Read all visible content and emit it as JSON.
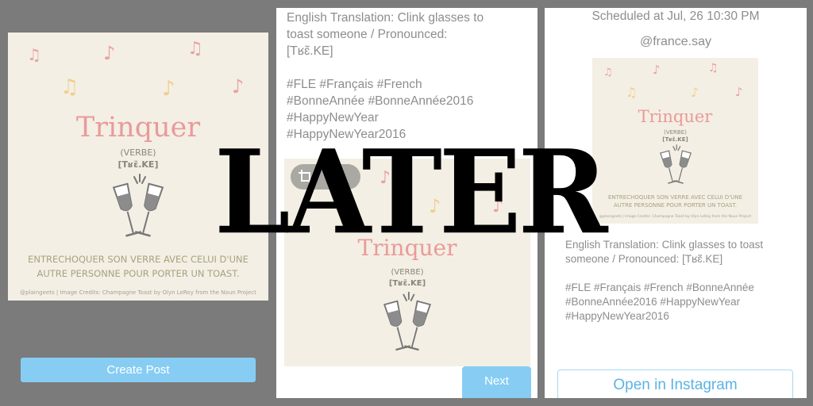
{
  "card": {
    "word": "Trinquer",
    "pos": "(VERBE)",
    "pron": "[Tʁɛ̃.KE]",
    "definition_line1": "ENTRECHOQUER SON VERRE AVEC CELUI D'UNE",
    "definition_line2": "AUTRE PERSONNE POUR PORTER UN TOAST.",
    "credit": "@plaingeets  |  Image Credits: Champagne Toast by Olyn LeRoy from the Noun Project"
  },
  "left_panel": {
    "create_button": "Create Post"
  },
  "middle_panel": {
    "caption": "English Translation: Clink glasses to\ntoast someone / Pronounced:\n[Tʁɛ̃.KE]\n\n#FLE #Français #French\n#BonneAnnée #BonneAnnée2016\n#HappyNewYear\n#HappyNewYear2016",
    "next_button": "Next",
    "crop_icon": "crop-icon"
  },
  "right_panel": {
    "scheduled": "Scheduled at Jul, 26 10:30 PM",
    "account": "@france.say",
    "caption": "English Translation: Clink glasses to toast\nsomeone / Pronounced: [Tʁɛ̃.KE]\n\n#FLE #Français #French #BonneAnnée\n#BonneAnnée2016 #HappyNewYear\n#HappyNewYear2016",
    "instagram_button": "Open in Instagram"
  },
  "overlay": {
    "headline": "LATER"
  },
  "colors": {
    "background": "#7b7b7b",
    "card": "#f3efe4",
    "accent_blue": "#87cdf3",
    "title_pink": "#ea9a9a",
    "note_pink": "#e9a1a1",
    "note_gold": "#f1cf8b"
  }
}
